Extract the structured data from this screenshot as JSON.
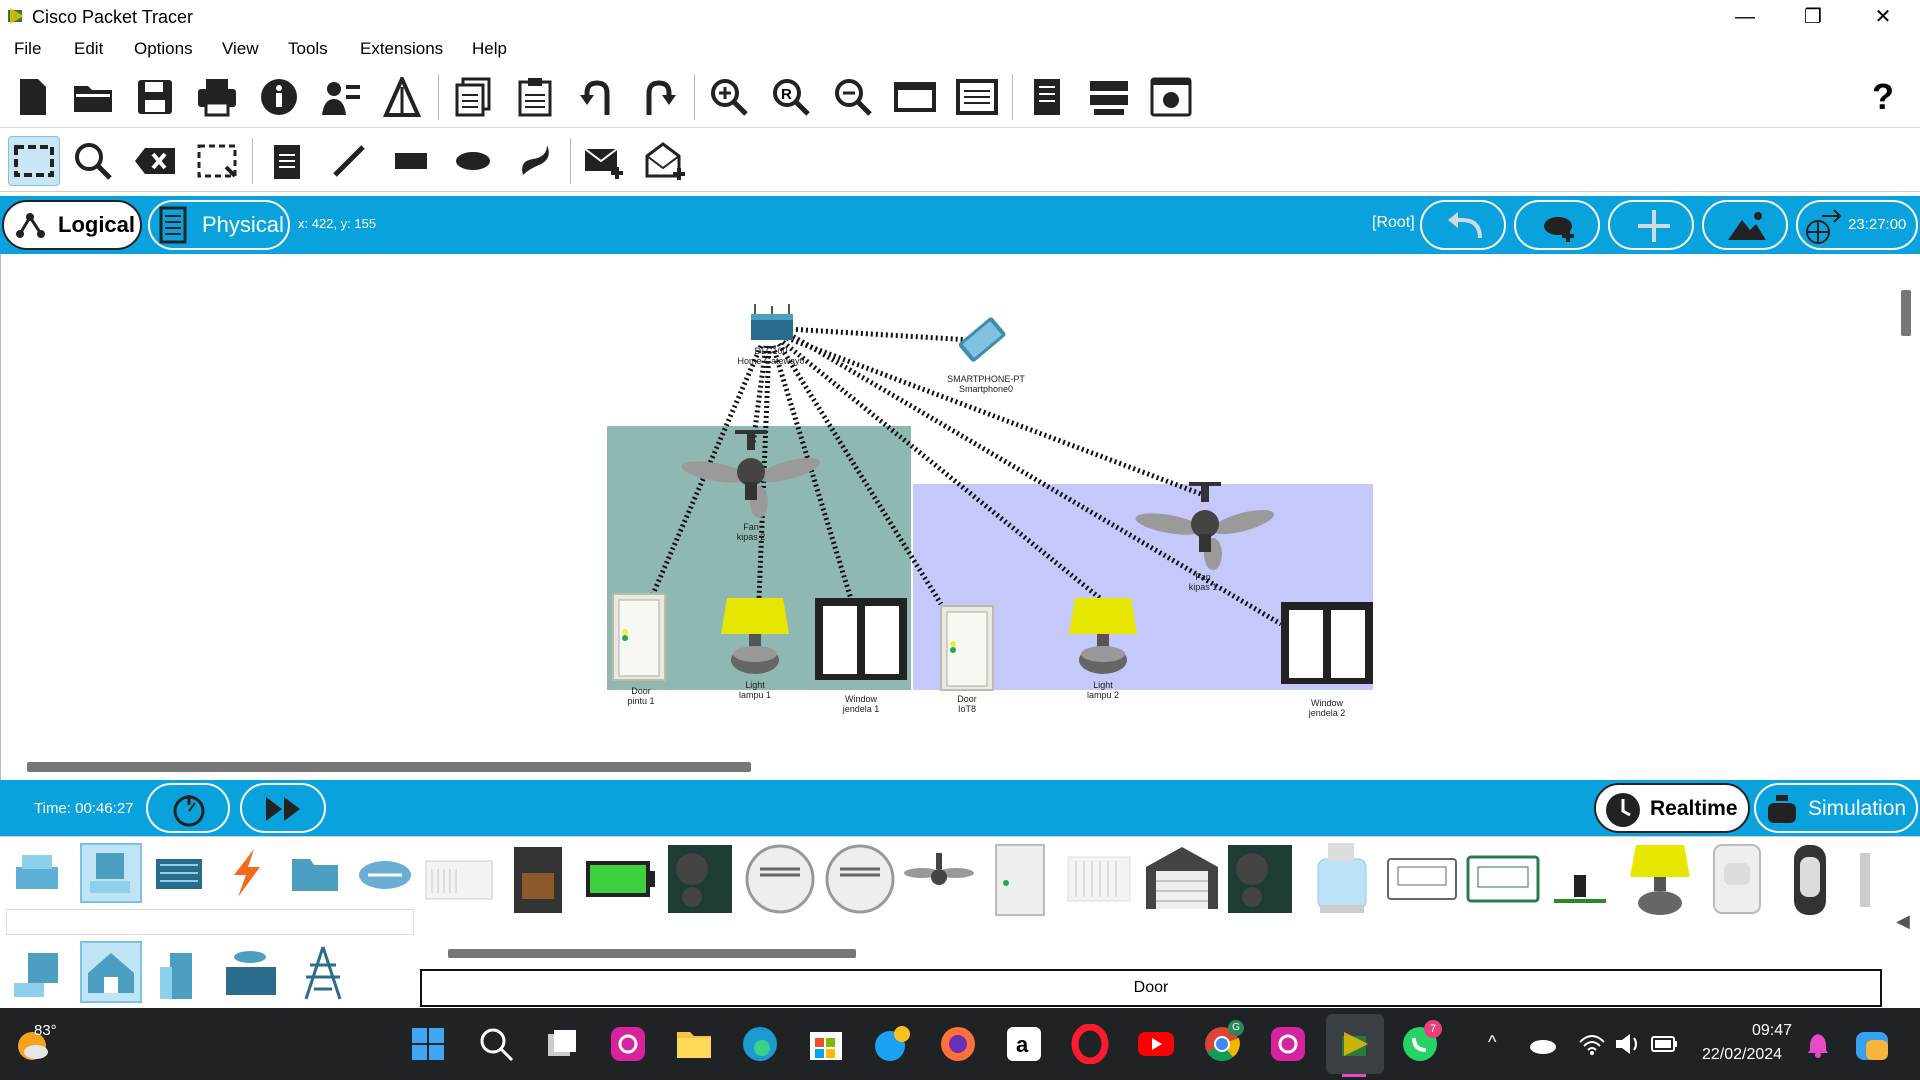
{
  "window": {
    "title": "Cisco Packet Tracer",
    "minimize": "—",
    "maximize": "❐",
    "close": "✕"
  },
  "menu": [
    "File",
    "Edit",
    "Options",
    "View",
    "Tools",
    "Extensions",
    "Help"
  ],
  "mode_bar": {
    "logical_label": "Logical",
    "physical_label": "Physical",
    "coords": "x: 422, y: 155",
    "root_label": "[Root]",
    "clock": "23:27:00"
  },
  "devices": [
    {
      "name": "home-gateway",
      "line1": "DLC100",
      "line2": "Home Gateway0"
    },
    {
      "name": "smartphone",
      "line1": "SMARTPHONE-PT",
      "line2": "Smartphone0"
    },
    {
      "name": "fan-kipas2",
      "line1": "Fan",
      "line2": "kipas 2"
    },
    {
      "name": "fan-kipas1",
      "line1": "Fan",
      "line2": "kipas 1"
    },
    {
      "name": "door-pintu1",
      "line1": "Door",
      "line2": "pintu 1"
    },
    {
      "name": "light-lampu1",
      "line1": "Light",
      "line2": "lampu 1"
    },
    {
      "name": "window-jendela1",
      "line1": "Window",
      "line2": "jendela 1"
    },
    {
      "name": "door-iot8",
      "line1": "Door",
      "line2": "IoT8"
    },
    {
      "name": "light-lampu2",
      "line1": "Light",
      "line2": "lampu 2"
    },
    {
      "name": "window-jendela2",
      "line1": "Window",
      "line2": "jendela 2"
    }
  ],
  "time_bar": {
    "time": "Time: 00:46:27",
    "realtime_label": "Realtime",
    "simulation_label": "Simulation"
  },
  "device_panel": {
    "selected_name": "Door"
  },
  "taskbar": {
    "weather": "83°",
    "time": "09:47",
    "date": "22/02/2024",
    "whatsapp_badge": "7",
    "chrome_badge": "G"
  },
  "colors": {
    "accent": "#0aa2dd",
    "room1": "#8fb8b2",
    "room2": "#c5c8fb"
  }
}
